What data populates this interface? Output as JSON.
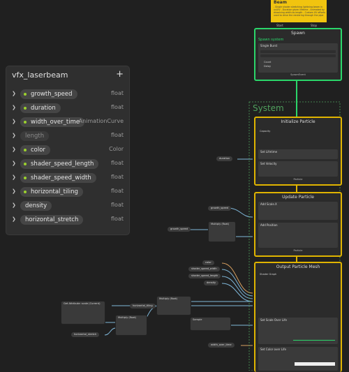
{
  "blackboard": {
    "title": "vfx_laserbeam",
    "add_label": "+",
    "properties": [
      {
        "name": "growth_speed",
        "type": "float",
        "exposed": true
      },
      {
        "name": "duration",
        "type": "float",
        "exposed": true
      },
      {
        "name": "width_over_time",
        "type": "AnimationCurve",
        "exposed": true
      },
      {
        "name": "length",
        "type": "float",
        "exposed": false
      },
      {
        "name": "color",
        "type": "Color",
        "exposed": true
      },
      {
        "name": "shader_speed_length",
        "type": "float",
        "exposed": true
      },
      {
        "name": "shader_speed_width",
        "type": "float",
        "exposed": true
      },
      {
        "name": "horizontal_tiling",
        "type": "float",
        "exposed": true
      },
      {
        "name": "density",
        "type": "float",
        "exposed": false
      },
      {
        "name": "horizontal_stretch",
        "type": "float",
        "exposed": false
      }
    ]
  },
  "sticky_note": {
    "title": "Beam",
    "body": "- Single shader stretching lightning beam in uv/UV\n- Duration given lifetime\n- Animated by dissolving width-to-length\n- Custom UV offsets used to drive the rendering through the pipe"
  },
  "spawn": {
    "ports": [
      "Start",
      "Stop"
    ],
    "header": "Spawn",
    "system_label": "Spawn system",
    "block": "Single Burst",
    "rows": [
      "Count",
      "Delay"
    ],
    "event": "SpawnEvent"
  },
  "system_title": "System",
  "initialize": {
    "header": "Initialize Particle",
    "capacity": "Capacity",
    "rows": [
      "Set Lifetime",
      "Set Velocity"
    ],
    "foot": "Particle"
  },
  "update": {
    "header": "Update Particle",
    "blocks": [
      "Add Scale.X",
      "Add Position"
    ],
    "foot": "Particle"
  },
  "output": {
    "header": "Output Particle Mesh",
    "blocks": [
      "Set Scale Over Life",
      "Set Color over Life"
    ],
    "shader": "Shader Graph"
  },
  "graph_props": {
    "duration": "duration",
    "growth_speed_a": "growth_speed",
    "growth_speed_b": "growth_speed",
    "color": "color",
    "speed_width": "shader_speed_width",
    "speed_length": "shader_speed_length",
    "density": "density",
    "horizontal_tiling": "horizontal_tiling",
    "horizontal_stretch": "horizontal_stretch",
    "width_over_time": "width_over_time"
  },
  "ops": {
    "multiply": "Multiply (float)",
    "set_attribute": "Get Attribute: scale (Current)",
    "sample": "Sample"
  },
  "colors": {
    "bg": "#202020",
    "spawn": "#2bd66a",
    "system": "#e0b400",
    "note": "#f1c40f",
    "exposed": "#9bd12e"
  }
}
